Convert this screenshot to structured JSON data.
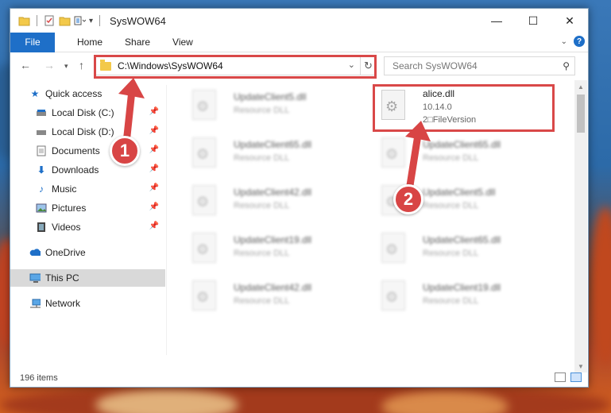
{
  "window": {
    "title": "SysWOW64"
  },
  "window_buttons": {
    "minimize": "—",
    "maximize": "☐",
    "close": "✕"
  },
  "ribbon": {
    "tabs": [
      "File",
      "Home",
      "Share",
      "View"
    ]
  },
  "address": {
    "path": "C:\\Windows\\SysWOW64"
  },
  "search": {
    "placeholder": "Search SysWOW64"
  },
  "sidebar": {
    "items": [
      {
        "label": "Quick access",
        "icon": "star-icon",
        "pinned": false
      },
      {
        "label": "Local Disk (C:)",
        "icon": "drive-icon",
        "pinned": true
      },
      {
        "label": "Local Disk (D:)",
        "icon": "drive-icon",
        "pinned": true
      },
      {
        "label": "Documents",
        "icon": "documents-icon",
        "pinned": true
      },
      {
        "label": "Downloads",
        "icon": "download-icon",
        "pinned": true
      },
      {
        "label": "Music",
        "icon": "music-icon",
        "pinned": true
      },
      {
        "label": "Pictures",
        "icon": "pictures-icon",
        "pinned": true
      },
      {
        "label": "Videos",
        "icon": "video-icon",
        "pinned": true
      },
      {
        "label": "OneDrive",
        "icon": "cloud-icon",
        "pinned": false
      },
      {
        "label": "This PC",
        "icon": "computer-icon",
        "pinned": false,
        "selected": true
      },
      {
        "label": "Network",
        "icon": "network-icon",
        "pinned": false
      }
    ]
  },
  "files": {
    "left": [
      {
        "name": "UpdateClient5.dll",
        "desc": "Resource DLL"
      },
      {
        "name": "UpdateClient65.dll",
        "desc": "Resource DLL"
      },
      {
        "name": "UpdateClient42.dll",
        "desc": "Resource DLL"
      },
      {
        "name": "UpdateClient19.dll",
        "desc": "Resource DLL"
      },
      {
        "name": "UpdateClient42.dll",
        "desc": "Resource DLL"
      }
    ],
    "right": [
      {
        "name": "alice.dll",
        "version": "10.14.0",
        "file_version": "2□FileVersion"
      },
      {
        "name": "UpdateClient65.dll",
        "desc": "Resource DLL"
      },
      {
        "name": "UpdateClient5.dll",
        "desc": "Resource DLL"
      },
      {
        "name": "UpdateClient65.dll",
        "desc": "Resource DLL"
      },
      {
        "name": "UpdateClient19.dll",
        "desc": "Resource DLL"
      }
    ]
  },
  "status": {
    "item_count": "196 items"
  },
  "callouts": {
    "one": "1",
    "two": "2"
  },
  "colors": {
    "accent": "#1e6fc8",
    "highlight": "#d94848"
  }
}
